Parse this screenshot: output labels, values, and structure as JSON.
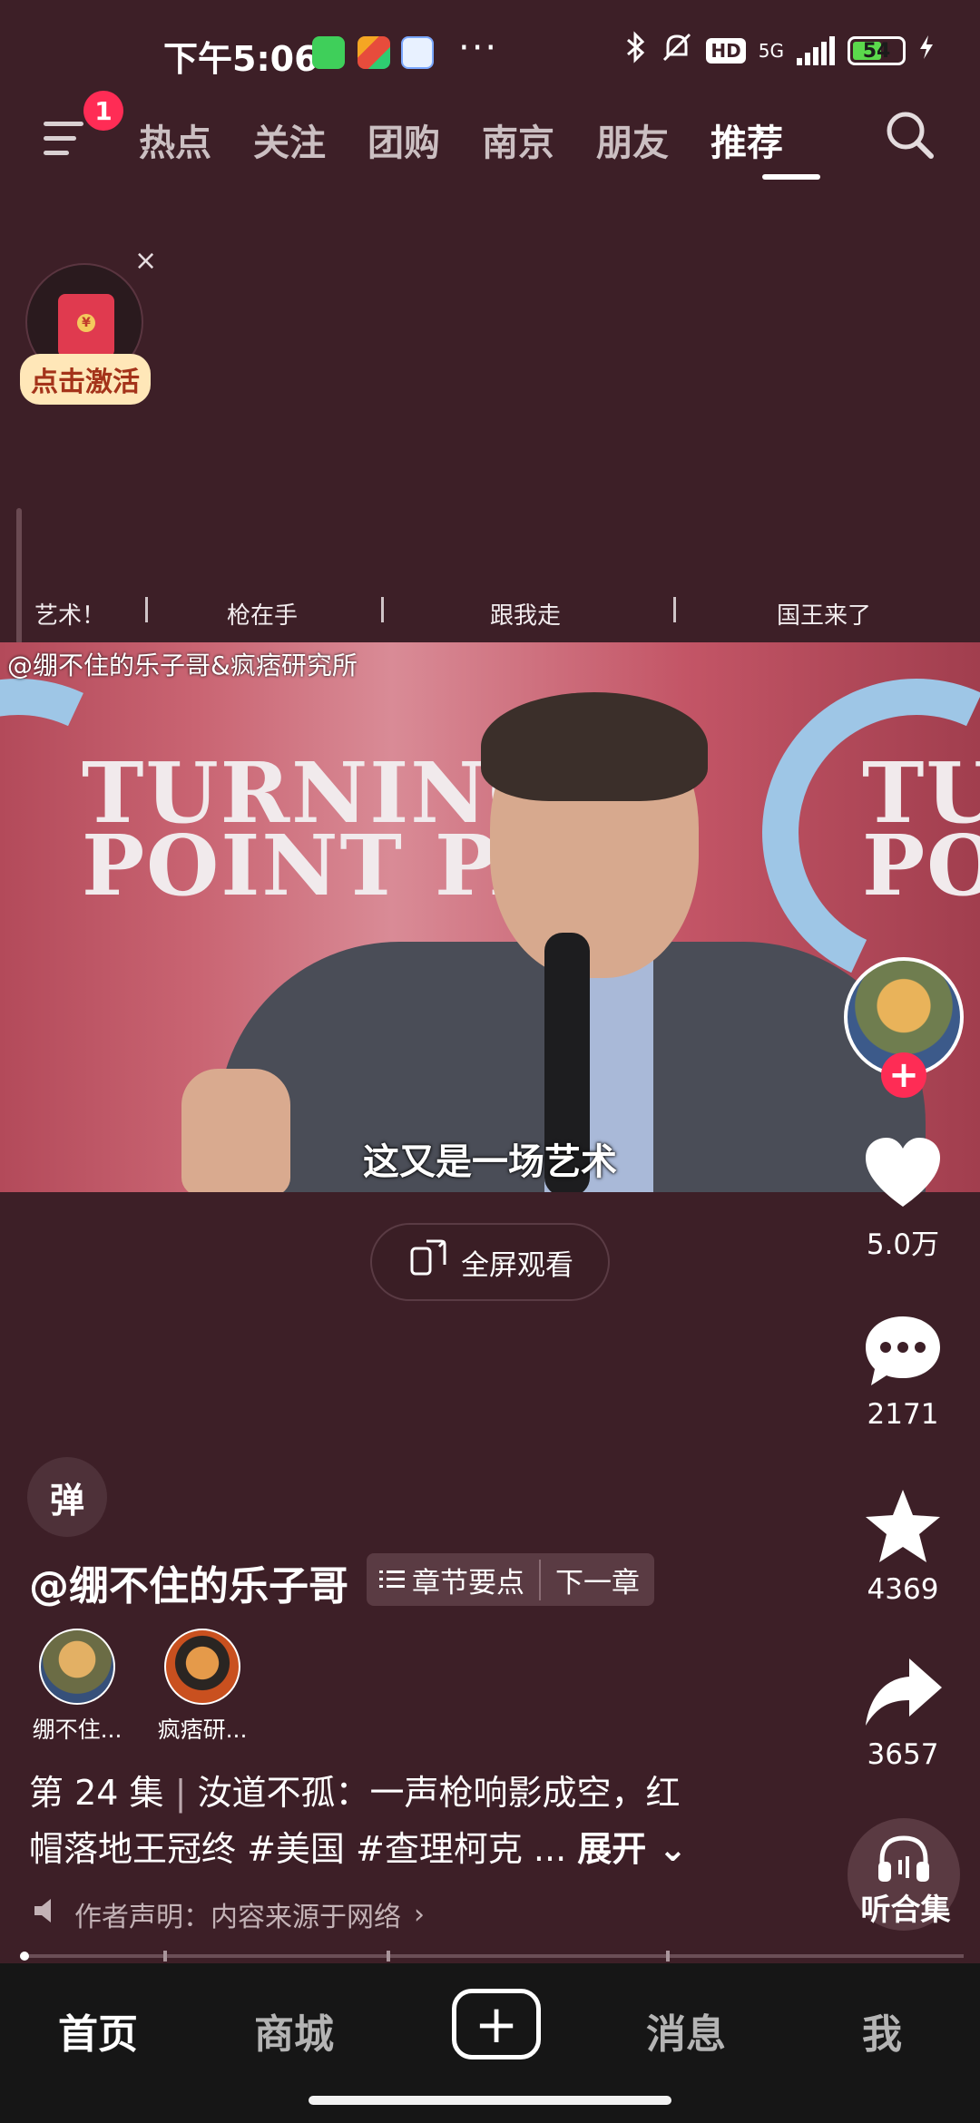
{
  "status_bar": {
    "time": "下午5:06",
    "dots": "···",
    "hd": "HD",
    "network": "5G",
    "battery": "54"
  },
  "top_nav": {
    "badge": "1",
    "tabs": [
      "热点",
      "关注",
      "团购",
      "南京",
      "朋友",
      "推荐"
    ],
    "active_tab": "推荐"
  },
  "promo": {
    "close": "×",
    "label": "点击激活"
  },
  "chapters": [
    "艺术！",
    "枪在手",
    "跟我走",
    "国王来了"
  ],
  "video": {
    "watermark": "@绷不住的乐子哥&疯痞研究所",
    "bg_line1": "TURNING",
    "bg_line2": "POINT PAC",
    "bg_right1": "TU",
    "bg_right2": "PO",
    "subtitle": "这又是一场艺术"
  },
  "fullscreen_label": "全屏观看",
  "rail": {
    "likes": "5.0万",
    "comments": "2171",
    "favorites": "4369",
    "shares": "3657",
    "listen": "听合集"
  },
  "info": {
    "danmu": "弹",
    "author": "@绷不住的乐子哥",
    "chapter_points": "章节要点",
    "next_chapter": "下一章",
    "coauthors": [
      "绷不住...",
      "疯痞研..."
    ],
    "episode": "第 24 集",
    "divider": "|",
    "desc_line1_rest": "汝道不孤：一声枪响影成空，红",
    "desc_line2": "帽落地王冠终 #美国 #查理柯克 ...",
    "expand": "展开",
    "declaration": "作者声明：内容来源于网络"
  },
  "bottom_nav": {
    "home": "首页",
    "mall": "商城",
    "plus": "+",
    "messages": "消息",
    "me": "我"
  },
  "colors": {
    "background": "#3d1f27",
    "accent": "#fe2c55",
    "bottom_nav": "#161616"
  }
}
